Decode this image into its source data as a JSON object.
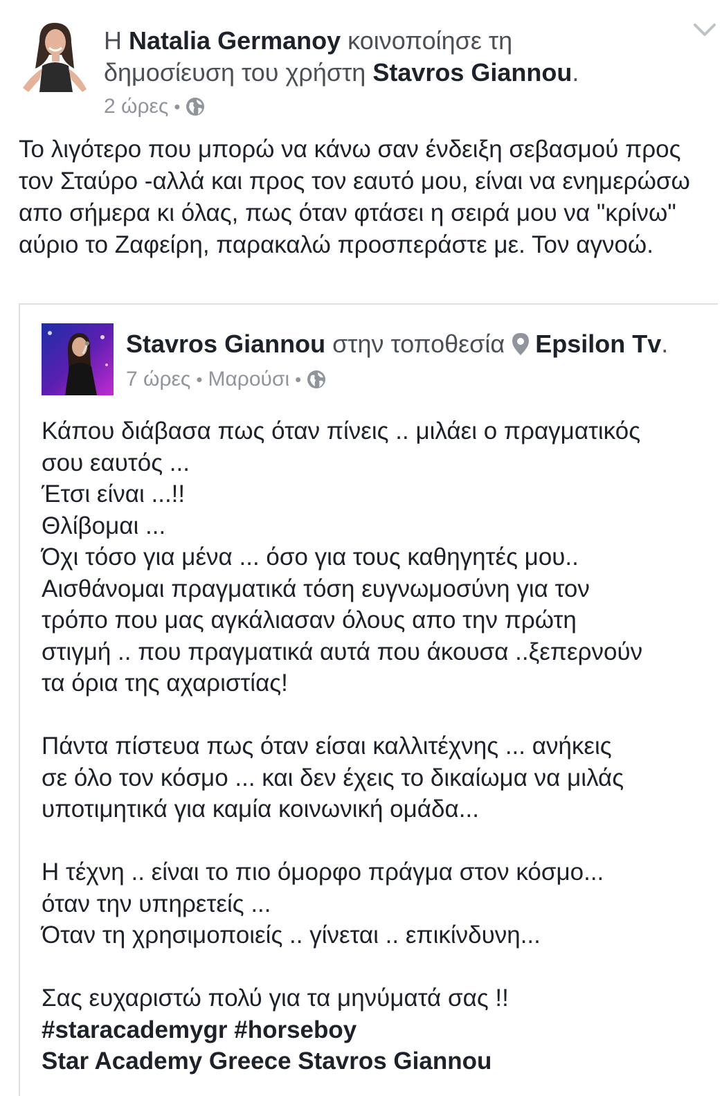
{
  "share_header": {
    "prefix": "Η",
    "sharer_name": "Natalia Germanoy",
    "middle": "κοινοποίησε τη",
    "line2_prefix": "δημοσίευση του χρήστη",
    "original_author": "Stavros Giannou",
    "suffix": ".",
    "time": "2 ώρες",
    "separator": "•",
    "privacy_icon": "globe-icon",
    "menu_icon": "chevron-down-icon"
  },
  "share_text": "Το λιγότερο που μπορώ να κάνω σαν ένδειξη σεβασμού προς τον Σταύρο -αλλά και προς τον εαυτό μου, είναι να ενημερώσω απο σήμερα κι όλας, πως όταν φτάσει η σειρά μου να \"κρίνω\" αύριο το Ζαφείρη, παρακαλώ προσπεράστε με. Τον αγνοώ.",
  "original_post": {
    "author": "Stavros Giannou",
    "location_prefix": "στην τοποθεσία",
    "location_icon": "location-pin-icon",
    "location": "Epsilon Tv",
    "suffix": ".",
    "time": "7 ώρες",
    "separator": "•",
    "place": "Μαρούσι",
    "privacy_icon": "globe-icon",
    "lines": [
      "Κάπου διάβασα πως όταν πίνεις .. μιλάει ο πραγματικός",
      "σου εαυτός ...",
      "Έτσι είναι ...!!",
      "Θλίβομαι ...",
      "Όχι τόσο για μένα ... όσο για τους καθηγητές μου..",
      "Αισθάνομαι πραγματικά τόση ευγνωμοσύνη για τον",
      "τρόπο που μας αγκάλιασαν όλους απο την πρώτη",
      "στιγμή .. που πραγματικά αυτά που άκουσα ..ξεπερνούν",
      "τα όρια της αχαριστίας!",
      "Πάντα πίστευα πως όταν είσαι καλλιτέχνης ... ανήκεις",
      "σε όλο τον κόσμο ... και δεν έχεις το δικαίωμα να μιλάς",
      "υποτιμητικά για καμία κοινωνική ομάδα...",
      "Η τέχνη .. είναι το πιο όμορφο πράγμα στον κόσμο...",
      "όταν την υπηρετείς ...",
      "Όταν τη χρησιμοποιείς .. γίνεται .. επικίνδυνη...",
      "Σας ευχαριστώ πολύ για τα μηνύματά σας !!"
    ],
    "hashtags": "#staracademygr #horseboy",
    "tags": "Star Academy Greece Stavros Giannou"
  }
}
